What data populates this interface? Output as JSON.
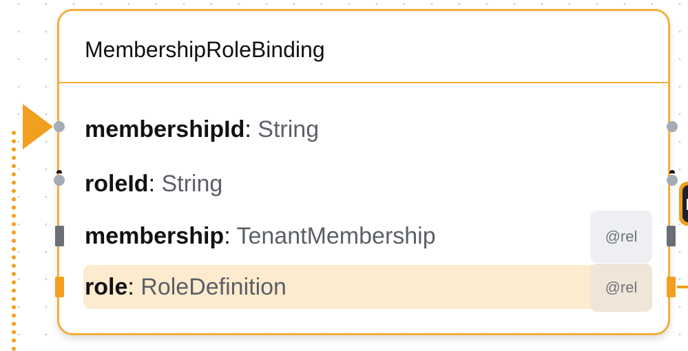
{
  "node": {
    "title": "MembershipRoleBinding",
    "fields": [
      {
        "name": "membershipId",
        "separator": ":",
        "type": "String",
        "badge": "",
        "highlighted": false
      },
      {
        "name": "roleId",
        "separator": ":",
        "type": "String",
        "badge": "",
        "highlighted": false
      },
      {
        "name": "membership",
        "separator": ":",
        "type": "TenantMembership",
        "badge": "@rel",
        "highlighted": false
      },
      {
        "name": "role",
        "separator": ":",
        "type": "RoleDefinition",
        "badge": "@rel",
        "highlighted": true
      }
    ]
  },
  "colors": {
    "accent": "#f29f1f",
    "node_border": "#f5ad3b",
    "highlight_row": "#fdebd0",
    "handle_dot": "#a5abb5",
    "handle_bar": "#6b6e75",
    "canvas_dots": "#c9ced6"
  },
  "icons": {
    "incoming_arrow": "arrow-right-icon",
    "scalar_handle": "dot-handle-icon",
    "relation_handle": "bar-handle-icon"
  }
}
